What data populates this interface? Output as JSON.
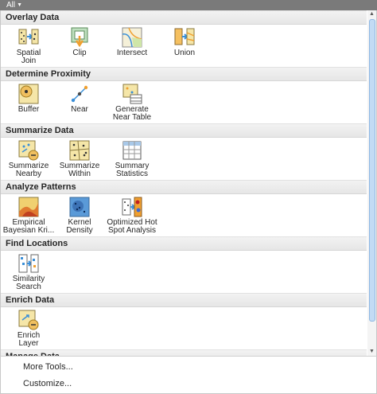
{
  "filter": {
    "label": "All",
    "caret_icon": "chevron-down-icon"
  },
  "groups": [
    {
      "title": "Overlay Data",
      "tools": [
        {
          "label": "Spatial\nJoin",
          "icon": "spatial-join-icon"
        },
        {
          "label": "Clip",
          "icon": "clip-icon"
        },
        {
          "label": "Intersect",
          "icon": "intersect-icon"
        },
        {
          "label": "Union",
          "icon": "union-icon"
        }
      ]
    },
    {
      "title": "Determine Proximity",
      "tools": [
        {
          "label": "Buffer",
          "icon": "buffer-icon"
        },
        {
          "label": "Near",
          "icon": "near-icon"
        },
        {
          "label": "Generate\nNear Table",
          "icon": "generate-near-table-icon"
        }
      ]
    },
    {
      "title": "Summarize Data",
      "tools": [
        {
          "label": "Summarize\nNearby",
          "icon": "summarize-nearby-icon"
        },
        {
          "label": "Summarize\nWithin",
          "icon": "summarize-within-icon"
        },
        {
          "label": "Summary\nStatistics",
          "icon": "summary-statistics-icon"
        }
      ]
    },
    {
      "title": "Analyze Patterns",
      "tools": [
        {
          "label": "Empirical\nBayesian Kri...",
          "icon": "empirical-bayesian-kriging-icon"
        },
        {
          "label": "Kernel\nDensity",
          "icon": "kernel-density-icon"
        },
        {
          "label": "Optimized Hot\nSpot Analysis",
          "icon": "optimized-hot-spot-icon"
        }
      ]
    },
    {
      "title": "Find Locations",
      "tools": [
        {
          "label": "Similarity\nSearch",
          "icon": "similarity-search-icon"
        }
      ]
    },
    {
      "title": "Enrich Data",
      "tools": [
        {
          "label": "Enrich\nLayer",
          "icon": "enrich-layer-icon"
        }
      ]
    },
    {
      "title": "Manage Data",
      "tools": []
    }
  ],
  "menu": {
    "more_tools": "More Tools...",
    "customize": "Customize..."
  },
  "colors": {
    "topbar": "#7a7a7a",
    "group_header": "#ececec",
    "scroll_thumb": "#c2dbf4",
    "icon_blue": "#3a8fd8",
    "icon_orange": "#f0a030",
    "icon_beige": "#f5e6a8"
  }
}
